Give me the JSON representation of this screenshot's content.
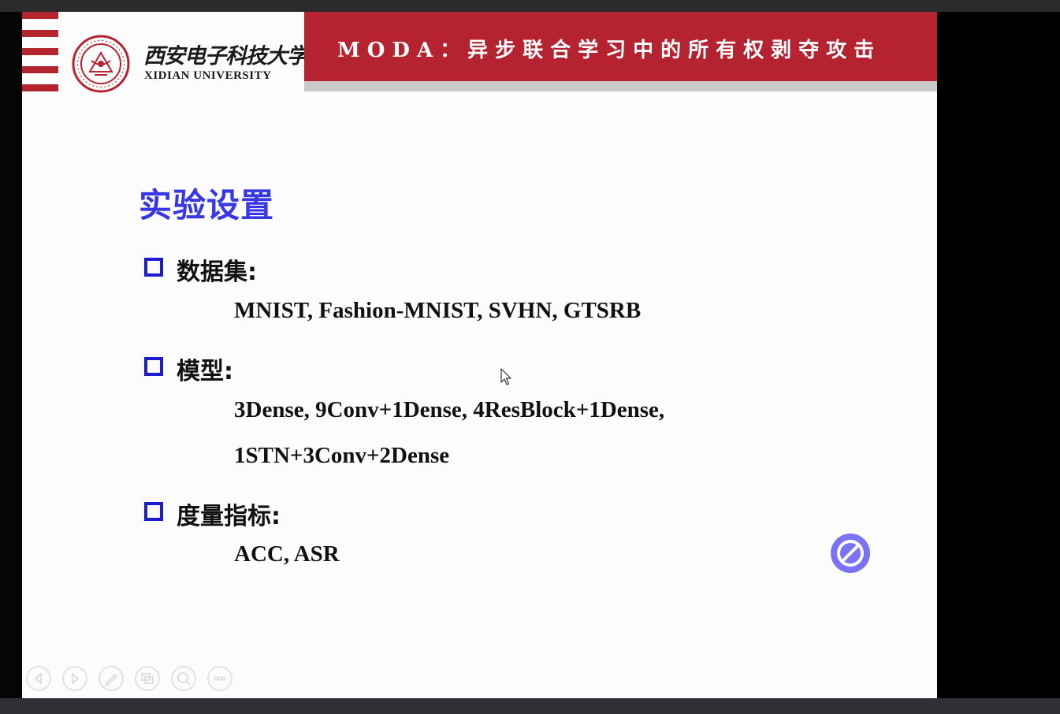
{
  "header": {
    "university_cn": "西安电子科技大学",
    "university_en": "XIDIAN UNIVERSITY",
    "presentation_title": "MODA：异步联合学习中的所有权剥夺攻击",
    "brand_color": "#b4232f"
  },
  "content": {
    "heading": "实验设置",
    "heading_color": "#3737e6",
    "sections": [
      {
        "label": "数据集:",
        "lines": [
          "MNIST, Fashion-MNIST, SVHN, GTSRB"
        ]
      },
      {
        "label": "模型:",
        "lines": [
          "3Dense,  9Conv+1Dense, 4ResBlock+1Dense,",
          "1STN+3Conv+2Dense"
        ]
      },
      {
        "label": "度量指标:",
        "lines": [
          "ACC,  ASR"
        ]
      }
    ]
  },
  "overlay": {
    "icon": "no-entry-icon",
    "color": "#7a73f4"
  },
  "slideshow_controls": [
    {
      "icon": "previous-slide-icon"
    },
    {
      "icon": "next-slide-icon"
    },
    {
      "icon": "pen-icon"
    },
    {
      "icon": "slide-overview-icon"
    },
    {
      "icon": "zoom-icon"
    },
    {
      "icon": "more-options-icon"
    }
  ]
}
